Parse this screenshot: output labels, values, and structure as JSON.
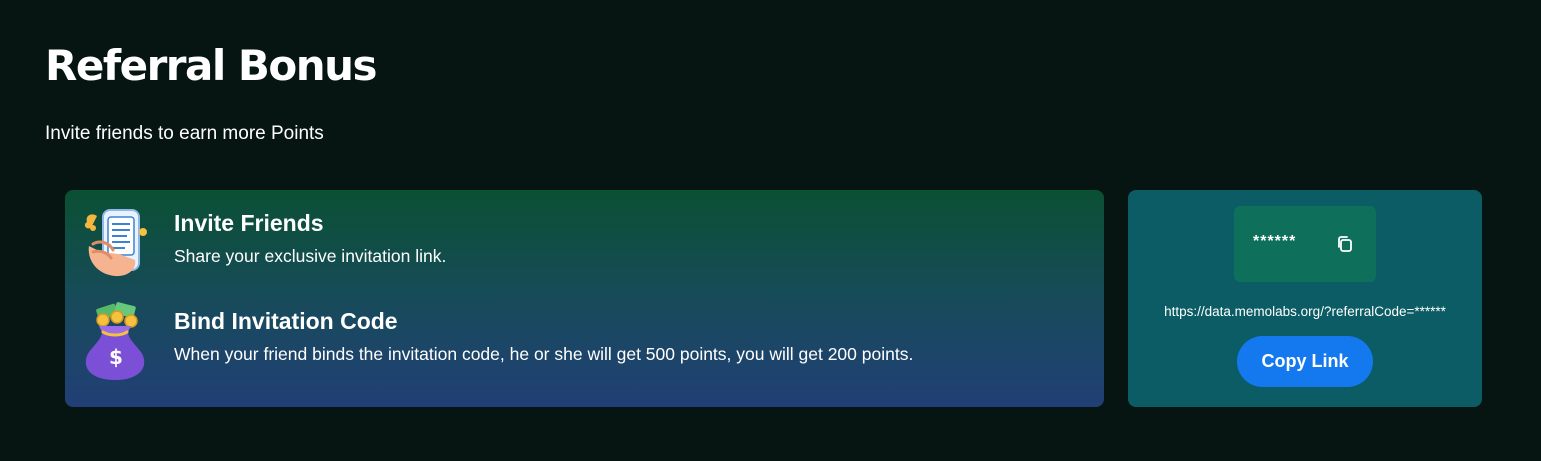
{
  "header": {
    "title": "Referral Bonus",
    "subtitle": "Invite friends to earn more Points"
  },
  "features": [
    {
      "icon": "phone-invite-icon",
      "title": "Invite Friends",
      "description": "Share your exclusive invitation link."
    },
    {
      "icon": "money-bag-icon",
      "title": "Bind Invitation Code",
      "description": "When your friend binds the invitation code, he or she will get 500 points, you will get 200 points."
    }
  ],
  "referral": {
    "code": "******",
    "copy_icon": "copy-icon",
    "link": "https://data.memolabs.org/?referralCode=******",
    "copy_button_label": "Copy Link"
  },
  "colors": {
    "background": "#061511",
    "referral_card": "#0b5c64",
    "code_box": "#0e6f5b",
    "button": "#1479ee",
    "gradient_top": "#0a5033",
    "gradient_bottom": "#213f76"
  }
}
